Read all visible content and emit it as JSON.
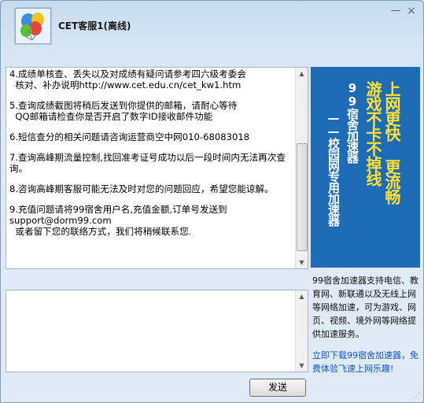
{
  "window": {
    "title": "CET客服1(离线)",
    "minimize_glyph": "—",
    "close_glyph": "×"
  },
  "chat": {
    "messages": [
      "4.成绩单核查、丢失以及对成绩有疑问请参考四六级考委会\n  核对、补办说明http://www.cet.edu.cn/cet_kw1.htm",
      "5.查询成绩截图将稍后发送到你提供的邮箱，请耐心等待\n  QQ邮箱请检查你是否开启了数字ID接收邮件功能",
      "6.短信查分的相关问题请咨询运营商空中网010-68083018",
      "7.查询高峰期流量控制,找回准考证号成功以后一段时间内无法再次查询。",
      "8.咨询高峰期客服可能无法及时对您的问题回应，希望您能谅解。",
      "9.充值问题请将99宿舍用户名,充值金额,订单号发送到support@dorm99.com\n  或者留下您的联络方式，我们将稍候联系您."
    ]
  },
  "send_button": {
    "label": "发送"
  },
  "banner": {
    "line1": "上网更快 更流畅",
    "line2": "游戏不卡不掉线",
    "line3": "99宿舍加速器",
    "line4": "——校园网专用加速器"
  },
  "sidebar": {
    "description": "99宿舍加速器支持电信、教育网、新联通以及无线上网等网络加速，可为游戏、网页、视频、境外网等网络提供加速服务。",
    "link": "立即下载99宿舍加速器，免费体验飞速上网乐趣!"
  },
  "colors": {
    "banner_bg": "#1e6bb6",
    "banner_accent": "#ffe033",
    "link": "#1155cc"
  }
}
